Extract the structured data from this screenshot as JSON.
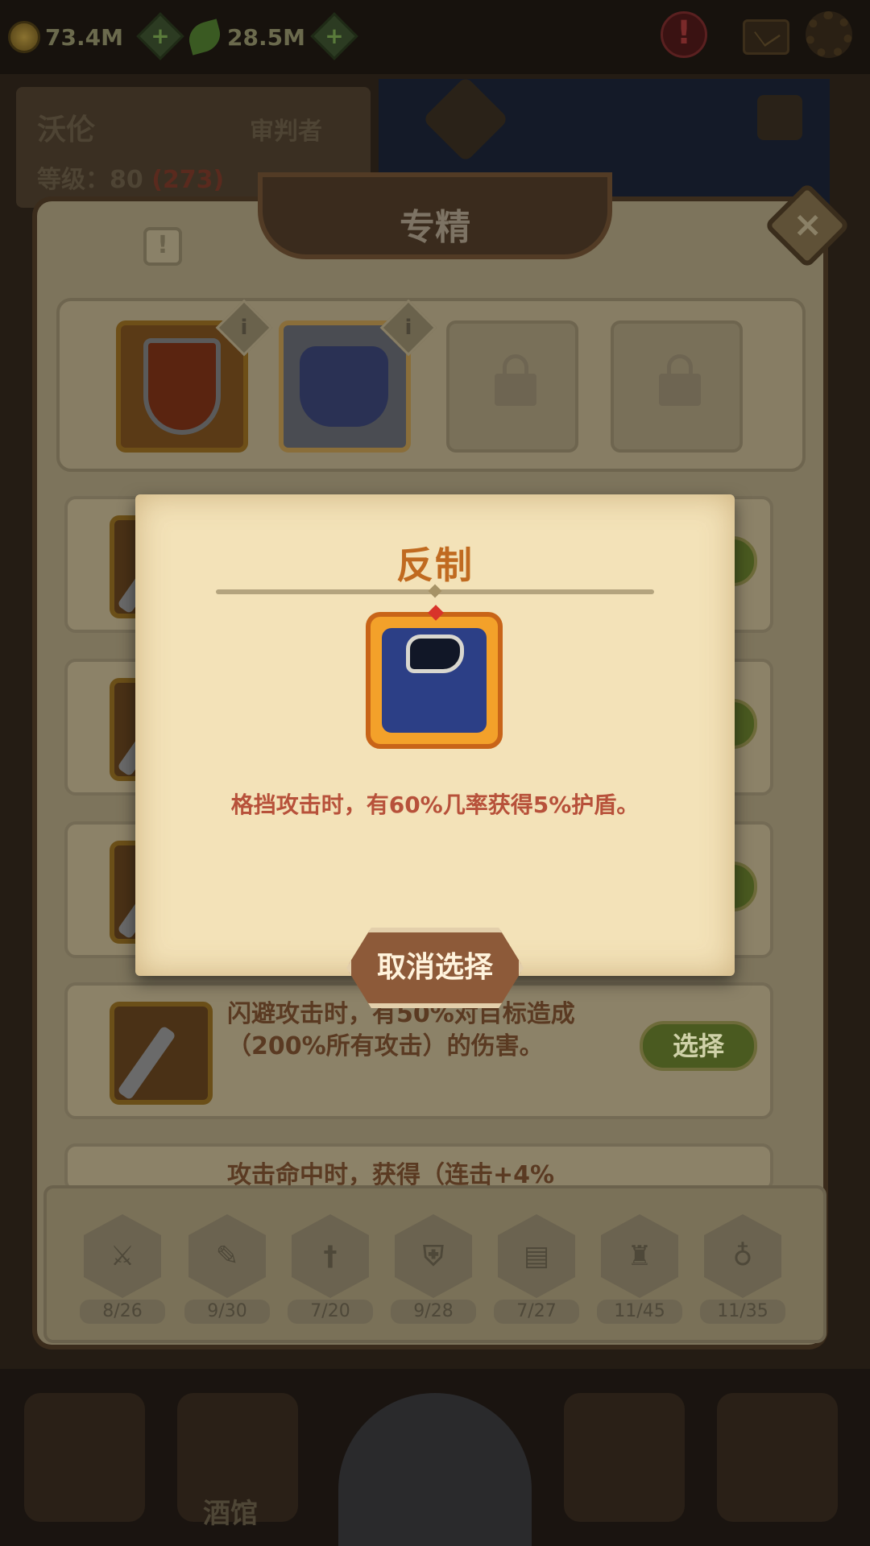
{
  "topbar": {
    "gold": "73.4M",
    "gems": "28.5M"
  },
  "hero": {
    "name": "沃伦",
    "class": "审判者",
    "level_label": "等级：80",
    "level_extra": "(273)"
  },
  "panel": {
    "title": "专精",
    "close_label": "×",
    "info_label": "!"
  },
  "slots": {
    "info_label": "i"
  },
  "rows": [
    {
      "text": ""
    },
    {
      "text": ""
    },
    {
      "text": ""
    },
    {
      "text": "闪避攻击时，有50%对目标造成（200%所有攻击）的伤害。",
      "button": "选择"
    },
    {
      "text": "攻击命中时，获得（连击+4%"
    }
  ],
  "tabs": [
    {
      "count": "8/26"
    },
    {
      "count": "9/30"
    },
    {
      "count": "7/20"
    },
    {
      "count": "9/28"
    },
    {
      "count": "7/27"
    },
    {
      "count": "11/45"
    },
    {
      "count": "11/35"
    }
  ],
  "nav": {
    "tavern_label": "酒馆"
  },
  "modal": {
    "title": "反制",
    "description": "格挡攻击时，有60%几率获得5%护盾。",
    "cancel_label": "取消选择"
  }
}
